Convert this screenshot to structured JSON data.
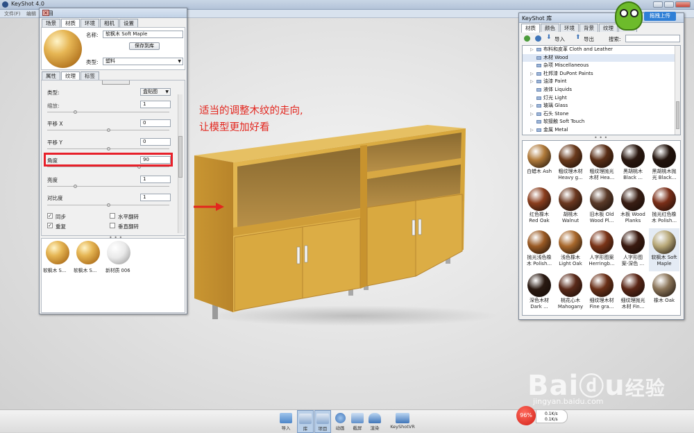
{
  "window": {
    "title": "KeyShot 4.0",
    "menu": [
      "文件(F)",
      "编辑"
    ]
  },
  "project": {
    "title": "项目",
    "tabs": [
      "场景",
      "材质",
      "环境",
      "相机",
      "设置"
    ],
    "name_label": "名称:",
    "name_value": "软枫木 Soft Maple",
    "save_button": "保存到库",
    "type_label": "类型:",
    "type_value": "塑料",
    "sub_tabs": [
      "属性",
      "纹理",
      "标签"
    ],
    "texture_type_label": "类型:",
    "texture_type_value": "盒贴图",
    "params": [
      {
        "label": "缩放:",
        "value": "1"
      },
      {
        "label": "平移 X",
        "value": "0"
      },
      {
        "label": "平移 Y",
        "value": "0"
      },
      {
        "label": "角度",
        "value": "90"
      },
      {
        "label": "亮度",
        "value": "1"
      },
      {
        "label": "对比度",
        "value": "1"
      }
    ],
    "checks": [
      {
        "label": "同步",
        "checked": true
      },
      {
        "label": "水平翻转",
        "checked": false
      },
      {
        "label": "重复",
        "checked": true
      },
      {
        "label": "垂直翻转",
        "checked": false
      }
    ],
    "thumbs": [
      "软枫木 S...",
      "软枫木 S...",
      "新材质 006"
    ]
  },
  "library": {
    "title": "KeyShot 库",
    "tabs": [
      "材质",
      "颜色",
      "环境",
      "背景",
      "纹理",
      "渲染"
    ],
    "toolbar": {
      "import": "导入",
      "export": "导出",
      "search_label": "搜索:",
      "search_value": ""
    },
    "tree": [
      {
        "label": "布料和皮革 Cloth and Leather",
        "expand": true,
        "selected": false
      },
      {
        "label": "木材 Wood",
        "expand": false,
        "selected": true
      },
      {
        "label": "杂项 Miscellaneous",
        "expand": false,
        "selected": false
      },
      {
        "label": "杜邦漆 DuPont Paints",
        "expand": true,
        "selected": false
      },
      {
        "label": "油漆 Paint",
        "expand": true,
        "selected": false
      },
      {
        "label": "液体 Liquids",
        "expand": false,
        "selected": false
      },
      {
        "label": "灯光 Light",
        "expand": false,
        "selected": false
      },
      {
        "label": "玻璃 Glass",
        "expand": true,
        "selected": false
      },
      {
        "label": "石头 Stone",
        "expand": true,
        "selected": false
      },
      {
        "label": "软接触 Soft Touch",
        "expand": false,
        "selected": false
      },
      {
        "label": "金属 Metal",
        "expand": true,
        "selected": false
      }
    ],
    "materials": [
      {
        "l1": "白蜡木 Ash",
        "l2": "",
        "c": "#b07a3a"
      },
      {
        "l1": "粗纹理木材",
        "l2": "Heavy g...",
        "c": "#6a3a1c"
      },
      {
        "l1": "粗纹理抛光",
        "l2": "木材 Hea...",
        "c": "#5a2e16"
      },
      {
        "l1": "黑胡桃木",
        "l2": "Black ...",
        "c": "#2a1810"
      },
      {
        "l1": "黑胡桃木抛",
        "l2": "光 Black...",
        "c": "#22130c"
      },
      {
        "l1": "红色橡木",
        "l2": "Red Oak",
        "c": "#8a3e1e"
      },
      {
        "l1": "胡桃木",
        "l2": "Walnut",
        "c": "#6b3820"
      },
      {
        "l1": "旧木板 Old",
        "l2": "Wood Pl...",
        "c": "#5a3a28"
      },
      {
        "l1": "木板 Wood",
        "l2": "Planks",
        "c": "#3a1e14"
      },
      {
        "l1": "抛光红色橡",
        "l2": "木 Polish...",
        "c": "#7a2e18"
      },
      {
        "l1": "抛光浅色橡",
        "l2": "木 Polish...",
        "c": "#9a5a24"
      },
      {
        "l1": "浅色橡木",
        "l2": "Light Oak",
        "c": "#a8682c"
      },
      {
        "l1": "人字形图案",
        "l2": "Herringb...",
        "c": "#7a3418"
      },
      {
        "l1": "人字形图",
        "l2": "案-深色 ...",
        "c": "#3a1a10"
      },
      {
        "l1": "软枫木 Soft",
        "l2": "Maple",
        "c": "#b8a878"
      },
      {
        "l1": "深色木材",
        "l2": "Dark ...",
        "c": "#2a1a12"
      },
      {
        "l1": "桃花心木",
        "l2": "Mahogany",
        "c": "#5a2a1a"
      },
      {
        "l1": "细纹理木材",
        "l2": "Fine gra...",
        "c": "#6a3018"
      },
      {
        "l1": "细纹理抛光",
        "l2": "木材 Fin...",
        "c": "#5a2616"
      },
      {
        "l1": "橡木 Oak",
        "l2": "",
        "c": "#8a7458"
      }
    ],
    "upload_button": "拖拽上传"
  },
  "annotation": {
    "line1": "适当的调整木纹的走向,",
    "line2": "让模型更加好看"
  },
  "bottom_toolbar": [
    {
      "label": "导入",
      "active": false
    },
    {
      "label": "库",
      "active": true
    },
    {
      "label": "项目",
      "active": true
    },
    {
      "label": "动画",
      "active": false
    },
    {
      "label": "截屏",
      "active": false
    },
    {
      "label": "渲染",
      "active": false
    },
    {
      "label": "KeyShotVR",
      "active": false
    }
  ],
  "net_widget": {
    "percent": "96%",
    "up": "0.1K/s",
    "down": "0.1K/s"
  },
  "colors": {
    "annotation": "#e3261e",
    "wood": "#d9aa3d",
    "frame": "#e8202a"
  }
}
